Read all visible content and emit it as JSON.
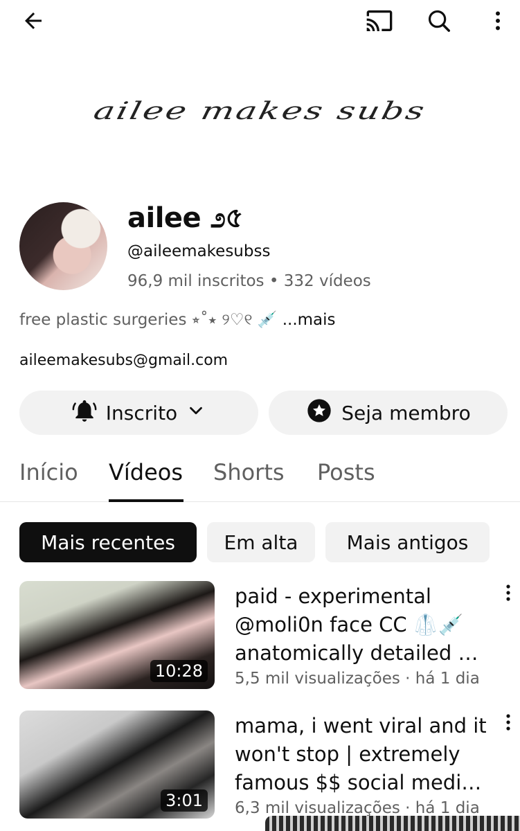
{
  "topbar": {
    "back_icon": "arrow-left-icon",
    "cast_icon": "cast-icon",
    "search_icon": "search-icon",
    "menu_icon": "more-vertical-icon"
  },
  "banner": {
    "text": "ailee makes subs"
  },
  "channel": {
    "name": "ailee ೨৫",
    "handle": "@aileemakesubss",
    "subscribers": "96,9 mil inscritos",
    "separator": " • ",
    "videos_count": "332 vídeos",
    "description": "free plastic surgeries ⭒˚⭑ ୨♡୧ 💉 ",
    "description_more": "...mais",
    "email": "aileemakesubs@gmail.com"
  },
  "actions": {
    "subscribe_label": "Inscrito",
    "member_label": "Seja membro"
  },
  "tabs": [
    {
      "label": "Início",
      "active": false
    },
    {
      "label": "Vídeos",
      "active": true
    },
    {
      "label": "Shorts",
      "active": false
    },
    {
      "label": "Posts",
      "active": false
    }
  ],
  "filters": [
    {
      "label": "Mais recentes",
      "active": true
    },
    {
      "label": "Em alta",
      "active": false
    },
    {
      "label": "Mais antigos",
      "active": false
    }
  ],
  "videos": [
    {
      "title": "paid - experimental @moli0n face CC 🥼💉 anatomically detailed …",
      "duration": "10:28",
      "views": "5,5 mil visualizações",
      "age": "há 1 dia"
    },
    {
      "title": "mama, i went viral and it won't stop | extremely famous $$ social medi…",
      "duration": "3:01",
      "views": "6,3 mil visualizações",
      "age": "há 1 dia"
    }
  ],
  "colors": {
    "text_primary": "#0f0f0f",
    "text_secondary": "#606060",
    "chip_bg": "#f2f2f2",
    "active_chip_bg": "#0f0f0f"
  }
}
